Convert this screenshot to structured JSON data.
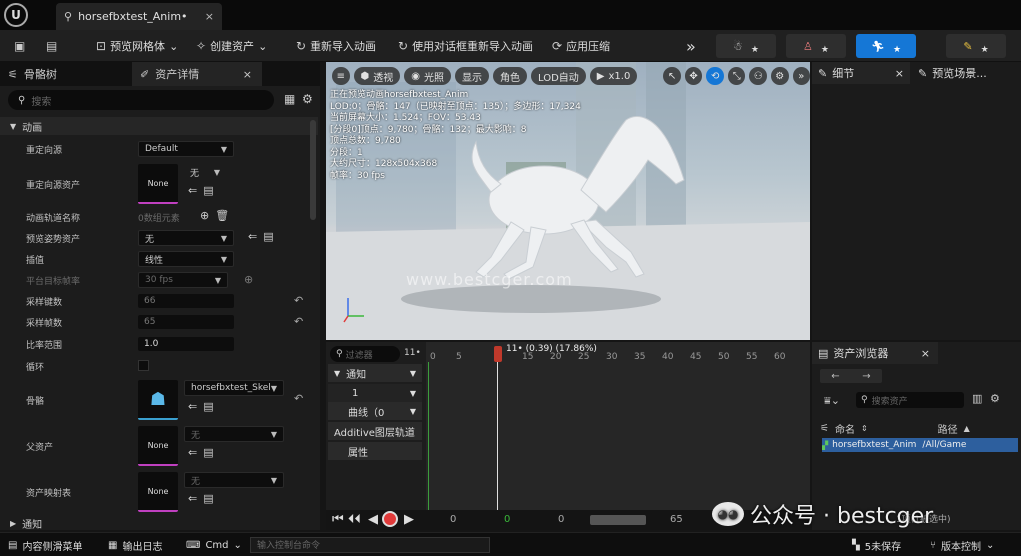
{
  "title": {
    "doc_tab": "horsefbxtest_Anim•",
    "close": "×"
  },
  "toolbar": {
    "preview_mesh": "预览网格体",
    "create_asset": "创建资产",
    "reimport": "重新导入动画",
    "reimport_dialog": "使用对话框重新导入动画",
    "apply_compress": "应用压缩",
    "more": "»"
  },
  "left_panel": {
    "tab1": "骨骼树",
    "tab2": "资产详情",
    "search_placeholder": "搜索",
    "section_anim": "动画",
    "section_more": "通知",
    "rows": {
      "retarget_source": {
        "label": "重定向源",
        "value": "Default"
      },
      "retarget_source_asset": {
        "label": "重定向源资产",
        "thumb": "None",
        "value": "无"
      },
      "anim_track_names": {
        "label": "动画轨道名称",
        "value": "0数组元素"
      },
      "preview_pose_asset": {
        "label": "预览姿势资产",
        "value": "无"
      },
      "interpolation": {
        "label": "插值",
        "value": "线性"
      },
      "platform_target_fps": {
        "label": "平台目标帧率",
        "value": "30 fps"
      },
      "sampled_keys": {
        "label": "采样键数",
        "value": "66"
      },
      "sampled_frames": {
        "label": "采样帧数",
        "value": "65"
      },
      "rate_scale": {
        "label": "比率范围",
        "value": "1.0"
      },
      "loop": {
        "label": "循环"
      },
      "skeleton": {
        "label": "骨骼",
        "value": "horsefbxtest_Skelet"
      },
      "parent_asset": {
        "label": "父资产",
        "thumb": "None",
        "value": "无"
      },
      "asset_mapping": {
        "label": "资产映射表",
        "thumb": "None",
        "value": "无"
      }
    }
  },
  "viewport": {
    "perspective": "透视",
    "lit": "光照",
    "show": "显示",
    "character": "角色",
    "lod": "LOD自动",
    "speed": "x1.0",
    "info_lines": [
      "正在预览动画horsefbxtest_Anim",
      "LOD:0；骨骼：147（已映射至顶点：135）；多边形：17,324",
      "当前屏幕大小：1.524；FOV：53.43",
      "[分段0]顶点：9,780；骨骼：132；最大影响：8",
      "顶点总数：9,780",
      "分段：1",
      "大约尺寸：128x504x368",
      "帧率：30 fps"
    ],
    "watermark": "www.bestcger.com"
  },
  "details": {
    "tab1": "细节",
    "tab2": "预览场景..."
  },
  "timeline": {
    "filter": "过滤器",
    "frame_indicator": "11•",
    "playhead_label": "11• (0.39) (17.86%)",
    "ruler": [
      "0",
      "5",
      "15",
      "20",
      "25",
      "30",
      "35",
      "40",
      "45",
      "50",
      "55",
      "60"
    ],
    "tracks": [
      "通知",
      "1",
      "曲线（0",
      "Additive图层轨道",
      "属性"
    ],
    "ctrl": {
      "start": "0",
      "cur": "0",
      "mid": "0",
      "end": "65"
    }
  },
  "assets": {
    "tab": "资产浏览器",
    "search_placeholder": "搜索资产",
    "col_name": "命名",
    "col_path": "路径",
    "item_name": "horsefbxtest_Anim",
    "item_path": "/All/Game",
    "footer": "1项(1被选中)"
  },
  "status": {
    "content_drawer": "内容侧滑菜单",
    "output_log": "输出日志",
    "cmd": "Cmd",
    "cmd_placeholder": "输入控制台命令",
    "unsaved": "5未保存",
    "version_control": "版本控制"
  },
  "wechat": {
    "text": "公众号 · bestcger"
  },
  "colors": {
    "accent": "#1577d6",
    "playhead": "#c0392b",
    "selection": "#2d5f9e"
  }
}
